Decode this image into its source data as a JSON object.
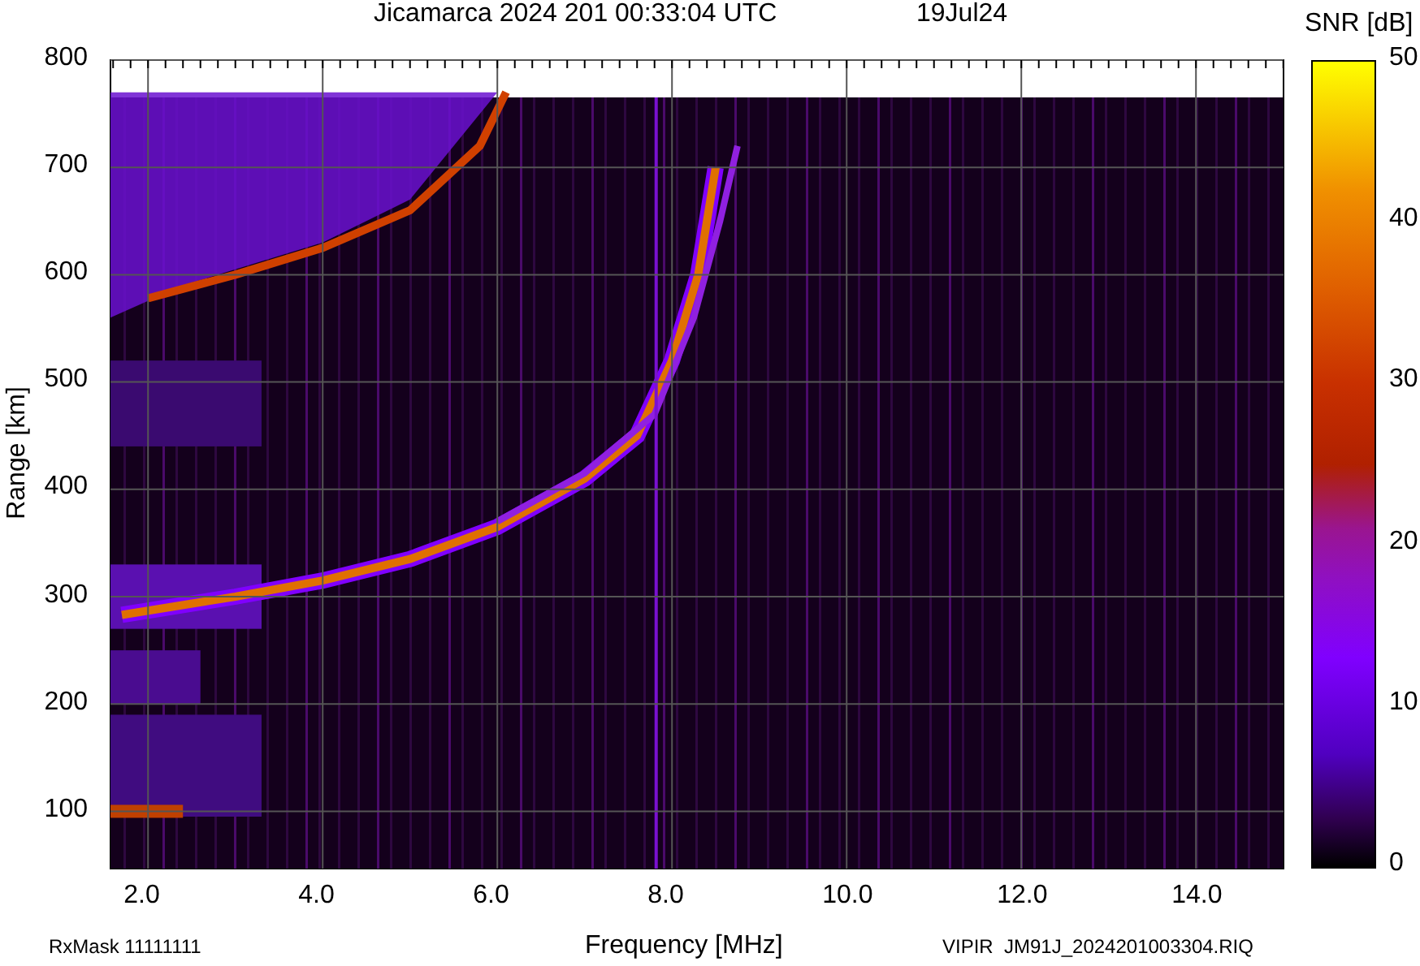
{
  "title": "Jicamarca 2024 201 00:33:04 UTC",
  "date": "19Jul24",
  "y_axis": {
    "label": "Range [km]",
    "ticks": [
      "800",
      "700",
      "600",
      "500",
      "400",
      "300",
      "200",
      "100"
    ]
  },
  "x_axis": {
    "label": "Frequency [MHz]",
    "ticks": [
      "2.0",
      "4.0",
      "6.0",
      "8.0",
      "10.0",
      "12.0",
      "14.0"
    ]
  },
  "colorbar": {
    "label": "SNR [dB]",
    "ticks": [
      "50",
      "40",
      "30",
      "20",
      "10",
      "0"
    ]
  },
  "footer_left": "RxMask 11111111",
  "footer_right": "VIPIR  JM91J_2024201003304.RIQ"
}
